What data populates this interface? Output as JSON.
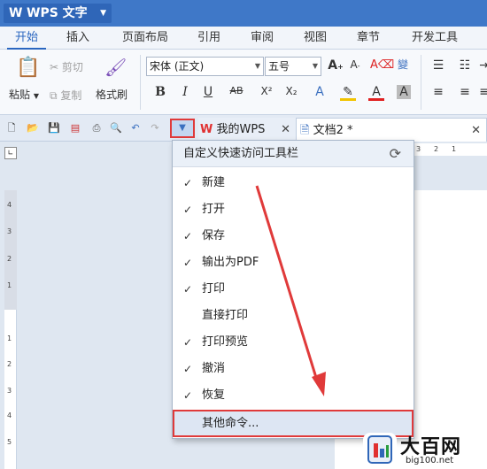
{
  "app": {
    "title": "WPS 文字",
    "logo_glyph": "W"
  },
  "menu_tabs": [
    {
      "label": "开始",
      "active": true
    },
    {
      "label": "插入"
    },
    {
      "label": "页面布局"
    },
    {
      "label": "引用"
    },
    {
      "label": "审阅"
    },
    {
      "label": "视图"
    },
    {
      "label": "章节"
    },
    {
      "label": "开发工具"
    }
  ],
  "ribbon": {
    "paste_label": "粘贴",
    "cut_label": "剪切",
    "copy_label": "复制",
    "format_painter_label": "格式刷",
    "font_name": "宋体 (正文)",
    "font_size": "五号"
  },
  "doc_tabs": [
    {
      "label": "我的WPS"
    },
    {
      "label": "文档2 *"
    }
  ],
  "menu": {
    "title": "自定义快速访问工具栏",
    "items": [
      {
        "label": "新建",
        "checked": true
      },
      {
        "label": "打开",
        "checked": true
      },
      {
        "label": "保存",
        "checked": true
      },
      {
        "label": "输出为PDF",
        "checked": true
      },
      {
        "label": "打印",
        "checked": true
      },
      {
        "label": "直接打印",
        "checked": false
      },
      {
        "label": "打印预览",
        "checked": true
      },
      {
        "label": "撤消",
        "checked": true
      },
      {
        "label": "恢复",
        "checked": true
      },
      {
        "label": "其他命令...",
        "checked": false
      }
    ]
  },
  "ruler": {
    "vertical_marks": [
      "4",
      "3",
      "2",
      "1",
      "1",
      "2",
      "3",
      "4",
      "5"
    ],
    "horizontal_marks": [
      "3",
      "2",
      "1"
    ]
  },
  "watermark": {
    "title": "大百网",
    "url": "big100.net"
  },
  "colors": {
    "accent": "#3f78c8",
    "highlight_border": "#e03a3a"
  }
}
